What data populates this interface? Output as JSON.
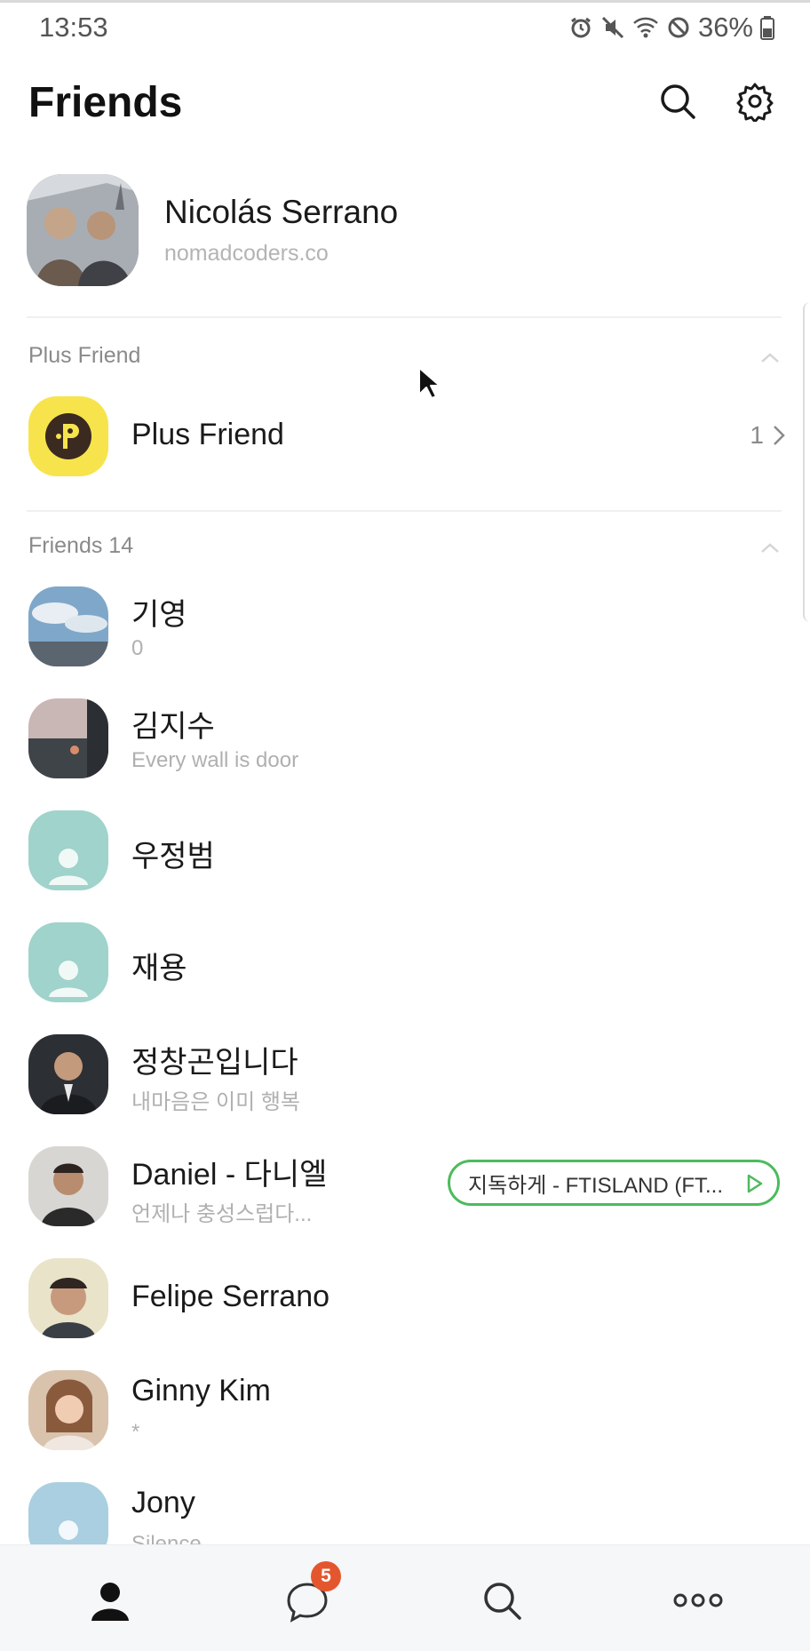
{
  "status_bar": {
    "time": "13:53",
    "battery": "36%",
    "icons": [
      "alarm-icon",
      "mute-icon",
      "wifi-icon",
      "block-icon",
      "battery-icon"
    ]
  },
  "header": {
    "title": "Friends",
    "search_icon": "search-icon",
    "settings_icon": "gear-icon"
  },
  "profile": {
    "name": "Nicolás Serrano",
    "status": "nomadcoders.co"
  },
  "plus_section": {
    "title": "Plus Friend",
    "item": {
      "name": "Plus Friend",
      "count": "1"
    }
  },
  "friends_section": {
    "title": "Friends 14",
    "friends": [
      {
        "name": "기영",
        "status": "0"
      },
      {
        "name": "김지수",
        "status": "Every wall is door"
      },
      {
        "name": "우정범",
        "status": ""
      },
      {
        "name": "재용",
        "status": ""
      },
      {
        "name": "정창곤입니다",
        "status": "내마음은 이미 행복"
      },
      {
        "name": "Daniel - 다니엘",
        "status": "언제나 충성스럽다..."
      },
      {
        "name": "Felipe Serrano",
        "status": ""
      },
      {
        "name": "Ginny Kim",
        "status": "*"
      },
      {
        "name": "Jony",
        "status": "Silence"
      }
    ]
  },
  "music": {
    "label": "지독하게 - FTISLAND (FT..."
  },
  "bottom_nav": {
    "tabs": [
      "friends-tab",
      "chats-tab",
      "search-tab",
      "more-tab"
    ],
    "chat_badge": "5"
  },
  "colors": {
    "accent_green": "#4cbb5c",
    "badge_red": "#e4572e",
    "plus_yellow": "#f7e44c",
    "default_avatar": "#9fd3cb"
  }
}
